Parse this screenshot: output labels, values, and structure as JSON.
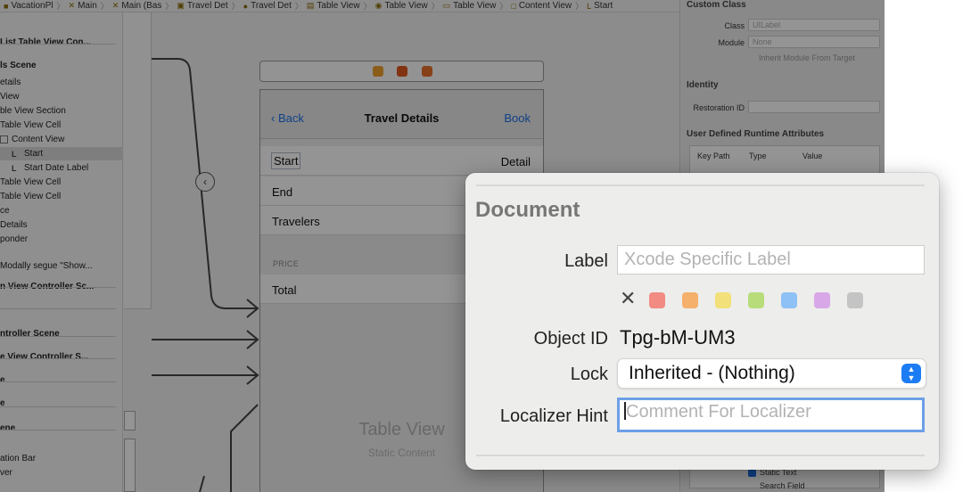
{
  "jumpbar": {
    "crumbs": [
      {
        "icon": "folder-icon",
        "label": "VacationPl"
      },
      {
        "icon": "storyboard-icon",
        "label": "Main"
      },
      {
        "icon": "storyboard-icon",
        "label": "Main (Bas"
      },
      {
        "icon": "scene-icon",
        "label": "Travel Det"
      },
      {
        "icon": "controller-icon",
        "label": "Travel Det"
      },
      {
        "icon": "tableview-icon",
        "label": "Table View"
      },
      {
        "icon": "section-icon",
        "label": "Table View"
      },
      {
        "icon": "cell-icon",
        "label": "Table View"
      },
      {
        "icon": "contentview-icon",
        "label": "Content View"
      },
      {
        "icon": "label-icon",
        "label": "Start"
      }
    ]
  },
  "outline": {
    "rows": [
      {
        "text": "List Table View Con...",
        "bold": true
      },
      {
        "text": "ls Scene",
        "bold": true
      },
      {
        "text": "etails"
      },
      {
        "text": "View"
      },
      {
        "text": "ble View Section"
      },
      {
        "text": "Table View Cell"
      },
      {
        "text": "Content View",
        "glyph": "box"
      },
      {
        "text": "Start",
        "glyph": "L",
        "selected": true
      },
      {
        "text": "Start Date Label",
        "glyph": "L"
      },
      {
        "text": "Table View Cell"
      },
      {
        "text": "Table View Cell"
      },
      {
        "text": "ce"
      },
      {
        "text": "Details"
      },
      {
        "text": "ponder"
      },
      {
        "text": ""
      },
      {
        "text": "Modally segue \"Show..."
      },
      {
        "text": "n View Controller Sc...",
        "bold": true
      },
      {
        "text": ""
      },
      {
        "text": ""
      },
      {
        "text": "ntroller Scene",
        "bold": true
      },
      {
        "text": "e View Controller S...",
        "bold": true
      },
      {
        "text": "e",
        "bold": true
      },
      {
        "text": "e",
        "bold": true
      },
      {
        "text": "ene",
        "bold": true
      },
      {
        "text": ""
      },
      {
        "text": "ation Bar"
      },
      {
        "text": "ver"
      }
    ]
  },
  "canvas": {
    "nav": {
      "back": "Back",
      "title": "Travel Details",
      "action": "Book"
    },
    "cells": [
      {
        "label": "Start",
        "detail": "Detail"
      },
      {
        "label": "End",
        "detail": ""
      },
      {
        "label": "Travelers",
        "detail": ""
      },
      {
        "label": "Total",
        "detail": ""
      }
    ],
    "price_header": "PRICE",
    "tableview_title": "Table View",
    "tableview_subtitle": "Static Content",
    "segue_glyph": "‹"
  },
  "inspector": {
    "custom_class": {
      "title": "Custom Class",
      "class_label": "Class",
      "class_value": "UILabel",
      "module_label": "Module",
      "module_value": "None",
      "inherit": "Inherit Module From Target"
    },
    "identity": {
      "title": "Identity",
      "restoration_label": "Restoration ID"
    },
    "udra": {
      "title": "User Defined Runtime Attributes",
      "cols": [
        "Key Path",
        "Type",
        "Value"
      ]
    },
    "checks": [
      "Static Text",
      "Search Field"
    ]
  },
  "popover": {
    "heading": "Document",
    "label_label": "Label",
    "label_placeholder": "Xcode Specific Label",
    "clear_glyph": "✕",
    "swatches": [
      "#f28b82",
      "#f5b06b",
      "#f2e07a",
      "#b8dc7a",
      "#8ec1f5",
      "#d8a7e8",
      "#c4c4c4"
    ],
    "object_id_label": "Object ID",
    "object_id_value": "Tpg-bM-UM3",
    "lock_label": "Lock",
    "lock_value": "Inherited - (Nothing)",
    "hint_label": "Localizer Hint",
    "hint_placeholder": "Comment For Localizer"
  }
}
